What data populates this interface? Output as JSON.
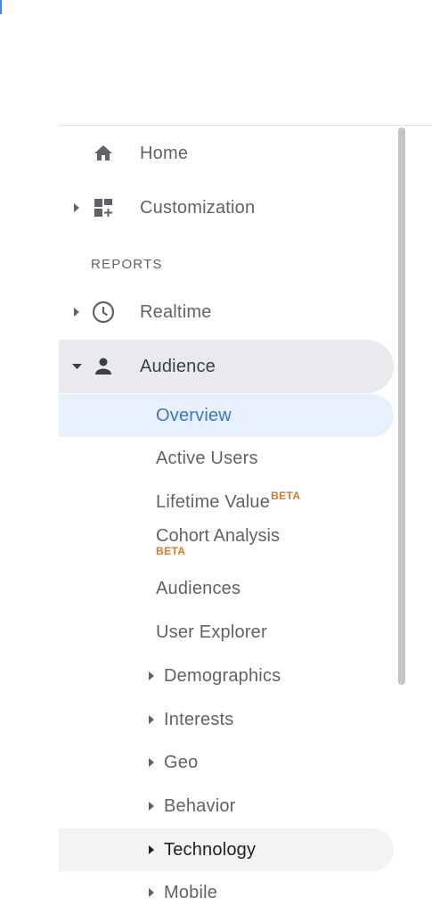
{
  "nav": {
    "home": {
      "label": "Home",
      "icon": "home-icon"
    },
    "customization": {
      "label": "Customization",
      "icon": "dashboard-icon"
    },
    "reports_header": "REPORTS",
    "realtime": {
      "label": "Realtime",
      "icon": "clock-icon"
    },
    "audience": {
      "label": "Audience",
      "icon": "person-icon",
      "items": [
        {
          "label": "Overview",
          "state": "selected"
        },
        {
          "label": "Active Users"
        },
        {
          "label": "Lifetime Value",
          "badge": "BETA"
        },
        {
          "label": "Cohort Analysis",
          "badge": "BETA"
        },
        {
          "label": "Audiences"
        },
        {
          "label": "User Explorer"
        },
        {
          "label": "Demographics",
          "expandable": true
        },
        {
          "label": "Interests",
          "expandable": true
        },
        {
          "label": "Geo",
          "expandable": true
        },
        {
          "label": "Behavior",
          "expandable": true
        },
        {
          "label": "Technology",
          "expandable": true,
          "state": "hover"
        },
        {
          "label": "Mobile",
          "expandable": true
        }
      ]
    }
  },
  "colors": {
    "accent": "#3c73d6",
    "beta": "#d77a2e",
    "selected_bg": "#e8f0fe",
    "expanded_bg": "#e8eaed",
    "hover_bg": "#f1f3f4"
  }
}
